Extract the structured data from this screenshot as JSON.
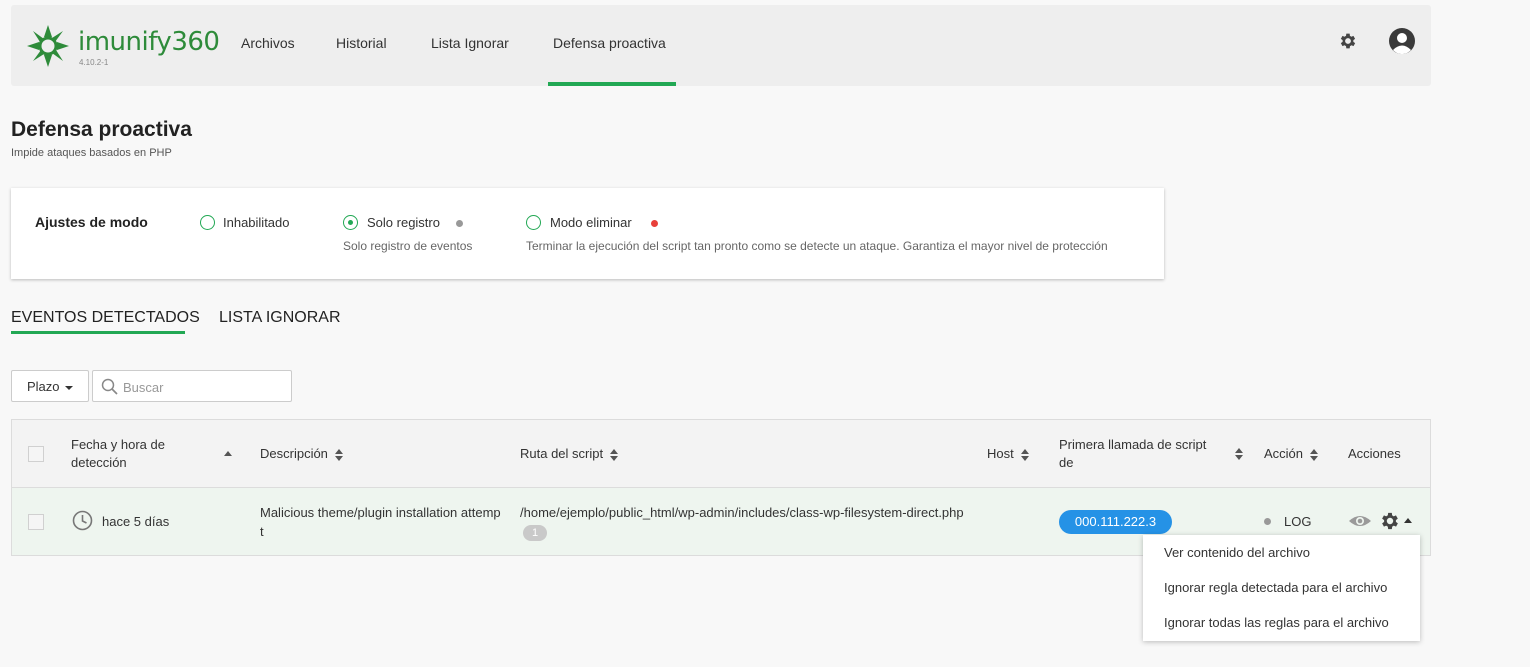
{
  "app": {
    "logo_text": "imunify360",
    "version": "4.10.2-1"
  },
  "nav": {
    "items": [
      {
        "label": "Archivos"
      },
      {
        "label": "Historial"
      },
      {
        "label": "Lista Ignorar"
      },
      {
        "label": "Defensa proactiva",
        "active": true
      }
    ]
  },
  "header_icons": [
    "gear-icon",
    "user-avatar-icon"
  ],
  "page": {
    "title": "Defensa proactiva",
    "subtitle": "Impide ataques basados en PHP"
  },
  "mode_settings": {
    "label": "Ajustes de modo",
    "options": [
      {
        "label": "Inhabilitado",
        "description": "",
        "selected": false,
        "dot_color": ""
      },
      {
        "label": "Solo registro",
        "description": "Solo registro de eventos",
        "selected": true,
        "dot_color": "#999999"
      },
      {
        "label": "Modo eliminar",
        "description": "Terminar la ejecución del script tan pronto como se detecte un ataque. Garantiza el mayor nivel de protección",
        "selected": false,
        "dot_color": "#e8403a"
      }
    ]
  },
  "tabs": [
    {
      "label": "EVENTOS DETECTADOS",
      "active": true
    },
    {
      "label": "LISTA IGNORAR",
      "active": false
    }
  ],
  "filters": {
    "period_label": "Plazo",
    "search_placeholder": "Buscar"
  },
  "table": {
    "columns": [
      {
        "label": "Fecha y hora de detección",
        "sort": "asc"
      },
      {
        "label": "Descripción",
        "sort": "both"
      },
      {
        "label": "Ruta del script",
        "sort": "both"
      },
      {
        "label": "Host",
        "sort": "both"
      },
      {
        "label": "Primera llamada de script de",
        "sort": "both"
      },
      {
        "label": "Acción",
        "sort": "both"
      },
      {
        "label": "Acciones",
        "sort": "none"
      }
    ],
    "rows": [
      {
        "time": "hace 5 días",
        "description": "Malicious theme/plugin installation attempt",
        "script_path": "/home/ejemplo/public_html/wp-admin/includes/class-wp-filesystem-direct.php",
        "path_count": "1",
        "host": "",
        "first_call_ip": "000.111.222.3",
        "action": "LOG"
      }
    ]
  },
  "row_actions_menu": {
    "items": [
      {
        "label": "Ver contenido del archivo"
      },
      {
        "label": "Ignorar regla detectada para el archivo"
      },
      {
        "label": "Ignorar todas las reglas para el archivo"
      }
    ]
  },
  "colors": {
    "accent": "#22a854",
    "ip_badge": "#2592e6",
    "row_highlight": "#eef5ef"
  }
}
